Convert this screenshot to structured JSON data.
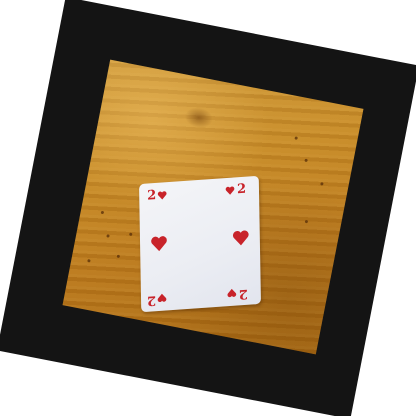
{
  "scene": {
    "subject": "playing card",
    "card": {
      "rank": "2",
      "suit": "hearts",
      "suit_icon": "heart-icon",
      "ink_color": "#c8232a",
      "face_color": "#eef0f5"
    },
    "colors": {
      "frame": "#141414",
      "wood": "#c08024"
    }
  }
}
